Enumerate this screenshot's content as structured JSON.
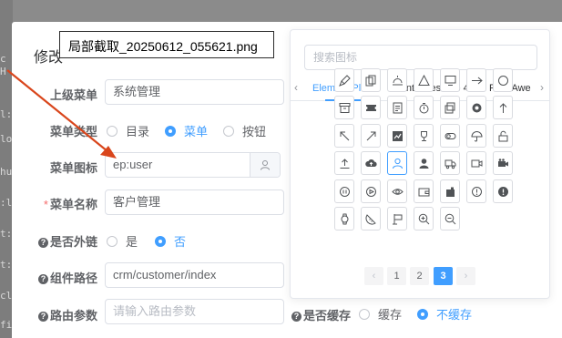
{
  "background_fragments": [
    {
      "text": "c"
    },
    {
      "text": "H"
    },
    {
      "text": "l:n"
    },
    {
      "text": "lo"
    },
    {
      "text": "hu"
    },
    {
      "text": ":li"
    },
    {
      "text": "t:li"
    },
    {
      "text": "t:li"
    },
    {
      "text": "cli"
    },
    {
      "text": "fig"
    }
  ],
  "dialog": {
    "title": "修改"
  },
  "screenshot_tooltip": "局部截取_20250612_055621.png",
  "form": {
    "parent_menu": {
      "label": "上级菜单",
      "value": "系统管理"
    },
    "menu_type": {
      "label": "菜单类型",
      "options": [
        "目录",
        "菜单",
        "按钮"
      ],
      "selected": "菜单"
    },
    "menu_icon": {
      "label": "菜单图标",
      "value": "ep:user",
      "suffix_icon": "user-icon"
    },
    "menu_name": {
      "label": "菜单名称",
      "required_mark": "*",
      "value": "客户管理"
    },
    "external_link": {
      "label": "是否外链",
      "help_mark": "?",
      "options": [
        "是",
        "否"
      ],
      "selected": "否"
    },
    "component_path": {
      "label": "组件路径",
      "help_mark": "?",
      "value": "crm/customer/index"
    },
    "route_params": {
      "label": "路由参数",
      "help_mark": "?",
      "placeholder": "请输入路由参数"
    },
    "cache": {
      "label": "是否缓存",
      "help_mark": "?",
      "options": [
        "缓存",
        "不缓存"
      ],
      "selected": "不缓存"
    }
  },
  "icon_picker": {
    "search_placeholder": "搜索图标",
    "prev_arrow": "‹",
    "next_arrow": "›",
    "tabs": [
      {
        "label": "Element Plus",
        "active": true
      },
      {
        "label": "Font Awesome 4",
        "active": false
      },
      {
        "label": "Font Awe",
        "active": false
      }
    ],
    "selected_icon": "user-icon",
    "icons": [
      "brush-icon",
      "copy-document-icon",
      "sunrise-icon",
      "warning-triangle-icon",
      "monitor-icon",
      "right-arrow-icon",
      "circle-icon",
      "box-icon",
      "ticket-icon",
      "document-icon",
      "stopwatch-icon",
      "tickets-icon",
      "setting-icon",
      "top-arrow-icon",
      "top-left-arrow-icon",
      "top-right-arrow-icon",
      "trend-charts-icon",
      "trophy-icon",
      "turn-off-icon",
      "umbrella-icon",
      "unlock-icon",
      "upload-icon",
      "upload-filled-icon",
      "user-icon",
      "user-filled-icon",
      "van-icon",
      "video-camera-icon",
      "video-camera-filled-icon",
      "video-pause-icon",
      "video-play-icon",
      "view-icon",
      "wallet-icon",
      "wallet-filled-icon",
      "warning-icon",
      "warning-filled-icon",
      "watch-icon",
      "watermelon-icon",
      "wind-power-icon",
      "zoom-in-icon",
      "zoom-out-icon"
    ],
    "pagination": {
      "prev": "‹",
      "next": "›",
      "pages": [
        "1",
        "2",
        "3"
      ],
      "current": "3"
    }
  },
  "colors": {
    "primary": "#409eff",
    "required": "#f56c6c",
    "arrow": "#d9461c"
  }
}
